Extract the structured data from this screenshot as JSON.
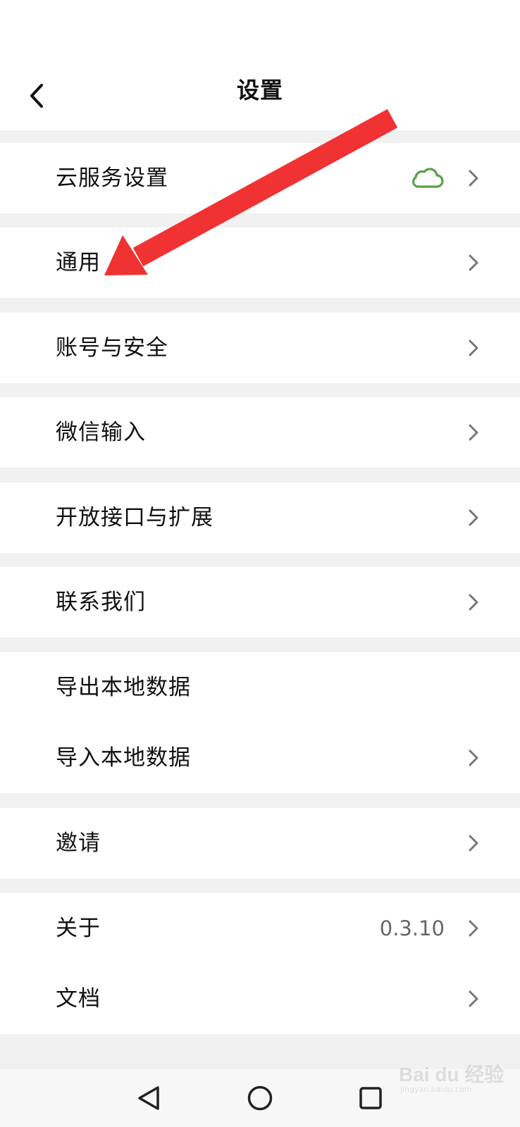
{
  "header": {
    "title": "设置",
    "back_icon": "chevron-left-icon"
  },
  "items": [
    {
      "label": "云服务设置",
      "status_icon": "cloud-icon",
      "status_color": "#5a9f4a"
    },
    {
      "label": "通用"
    },
    {
      "label": "账号与安全"
    },
    {
      "label": "微信输入"
    },
    {
      "label": "开放接口与扩展"
    },
    {
      "label": "联系我们"
    },
    {
      "label": "导出本地数据"
    },
    {
      "label": "导入本地数据"
    },
    {
      "label": "邀请"
    },
    {
      "label": "关于",
      "value": "0.3.10"
    },
    {
      "label": "文档"
    }
  ],
  "annotation": {
    "type": "red-arrow",
    "color": "#f03232",
    "points_to": "通用"
  },
  "navbar": {
    "back_icon": "triangle-back-icon",
    "home_icon": "circle-home-icon",
    "recents_icon": "square-recents-icon"
  },
  "watermark": {
    "text": "Bai du 经验",
    "sub": "jingyan.baidu.com"
  },
  "colors": {
    "background": "#f1f1f1",
    "row": "#ffffff",
    "chevron": "#777777",
    "text": "#111111"
  }
}
